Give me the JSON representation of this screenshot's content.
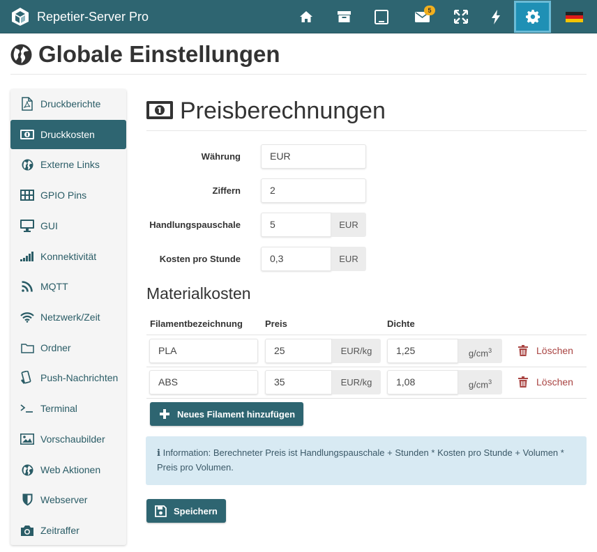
{
  "app": {
    "title": "Repetier-Server Pro",
    "messages_badge": "5",
    "colors": {
      "navbar": "#2e6571",
      "active_nav": "#1f90b5",
      "badge": "#f2b01e",
      "danger": "#a94442",
      "info_bg": "#d8eaf3"
    }
  },
  "nav": {
    "icons": [
      "home-icon",
      "archive-icon",
      "tablet-icon",
      "envelope-icon",
      "expand-icon",
      "bolt-icon",
      "gear-icon",
      "german-flag-icon"
    ],
    "active": "gear-icon"
  },
  "page": {
    "title": "Globale Einstellungen"
  },
  "sidebar": {
    "items": [
      {
        "label": "Druckberichte",
        "icon": "pdf-file-icon"
      },
      {
        "label": "Druckkosten",
        "icon": "money-icon",
        "active": true
      },
      {
        "label": "Externe Links",
        "icon": "globe-icon"
      },
      {
        "label": "GPIO Pins",
        "icon": "grid-icon"
      },
      {
        "label": "GUI",
        "icon": "monitor-icon"
      },
      {
        "label": "Konnektivität",
        "icon": "signal-icon"
      },
      {
        "label": "MQTT",
        "icon": "rss-icon"
      },
      {
        "label": "Netzwerk/Zeit",
        "icon": "wifi-icon"
      },
      {
        "label": "Ordner",
        "icon": "folder-icon"
      },
      {
        "label": "Push-Nachrichten",
        "icon": "mobile-icon"
      },
      {
        "label": "Terminal",
        "icon": "terminal-icon"
      },
      {
        "label": "Vorschaubilder",
        "icon": "image-icon"
      },
      {
        "label": "Web Aktionen",
        "icon": "globe-icon"
      },
      {
        "label": "Webserver",
        "icon": "shield-icon"
      },
      {
        "label": "Zeitraffer",
        "icon": "camera-icon"
      }
    ]
  },
  "main": {
    "title": "Preisberechnungen",
    "fields": {
      "currency": {
        "label": "Währung",
        "value": "EUR"
      },
      "digits": {
        "label": "Ziffern",
        "value": "2"
      },
      "handling": {
        "label": "Handlungspauschale",
        "value": "5",
        "unit": "EUR"
      },
      "hourly": {
        "label": "Kosten pro Stunde",
        "value": "0,3",
        "unit": "EUR"
      }
    },
    "material": {
      "title": "Materialkosten",
      "headers": {
        "name": "Filamentbezeichnung",
        "price": "Preis",
        "density": "Dichte"
      },
      "price_unit": "EUR/kg",
      "density_unit": "g/cm",
      "density_exp": "3",
      "delete_label": "Löschen",
      "rows": [
        {
          "name": "PLA",
          "price": "25",
          "density": "1,25"
        },
        {
          "name": "ABS",
          "price": "35",
          "density": "1,08"
        }
      ],
      "add_label": "Neues Filament hinzufügen"
    },
    "info": "Information: Berechneter Preis ist Handlungspauschale + Stunden * Kosten pro Stunde + Volumen * Preis pro Volumen.",
    "save_label": "Speichern"
  }
}
